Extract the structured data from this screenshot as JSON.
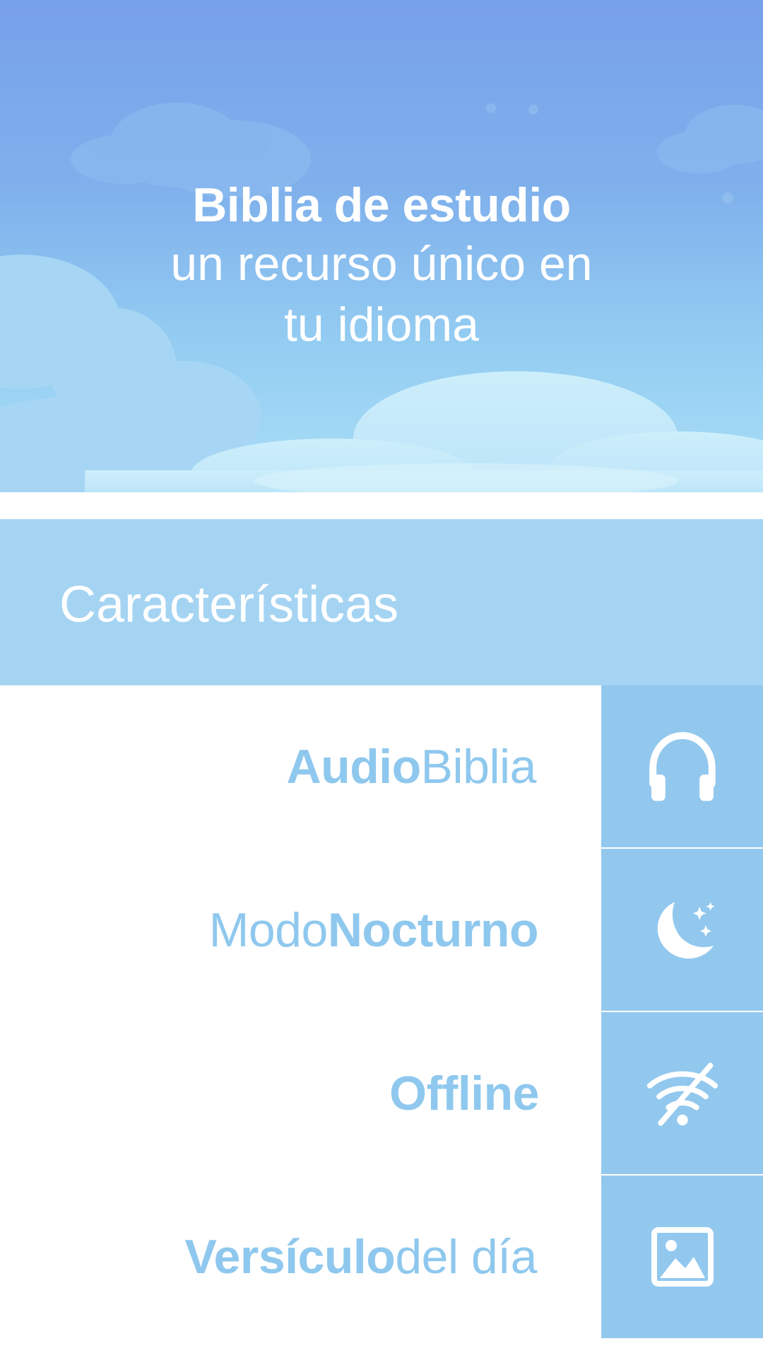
{
  "hero": {
    "title": "Biblia de estudio",
    "subtitle_line1": "un recurso único en",
    "subtitle_line2": "tu idioma"
  },
  "features_header": {
    "title": "Características"
  },
  "features": [
    {
      "bold": "Audio",
      "light_after": " Biblia",
      "light_before": "",
      "icon": "headphones-icon"
    },
    {
      "bold": "Nocturno",
      "light_before": "Modo ",
      "light_after": "",
      "icon": "moon-stars-icon"
    },
    {
      "bold": "Offline",
      "light_before": "",
      "light_after": "",
      "icon": "wifi-off-icon"
    },
    {
      "bold": "Versículo",
      "light_before": "",
      "light_after": " del día",
      "icon": "image-icon"
    }
  ],
  "colors": {
    "sky_top": "#77a0ea",
    "sky_bottom": "#a9def6",
    "header_band": "#a5d4f3",
    "icon_cell": "#92c8ee",
    "feature_text": "#8fc8ee"
  }
}
